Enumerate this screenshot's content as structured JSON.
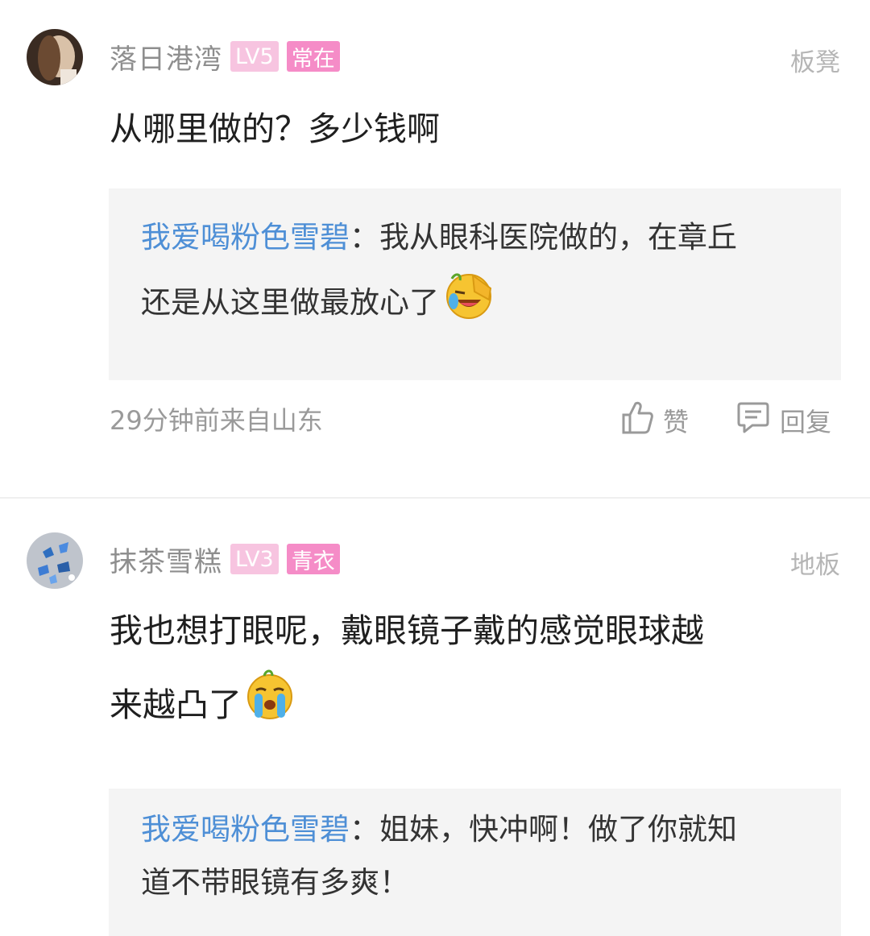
{
  "comments": [
    {
      "username": "落日港湾",
      "level": "LV5",
      "title_badge": "常在",
      "floor": "板凳",
      "text": "从哪里做的？多少钱啊",
      "reply": {
        "name": "我爱喝粉色雪碧",
        "sep": "：",
        "line1": "我从眼科医院做的，在章丘",
        "line2": "还是从这里做最放心了"
      },
      "time_location": "29分钟前来自山东",
      "like_label": "赞",
      "reply_label": "回复"
    },
    {
      "username": "抹茶雪糕",
      "level": "LV3",
      "title_badge": "青衣",
      "floor": "地板",
      "text_line1": "我也想打眼呢，戴眼镜子戴的感觉眼球越",
      "text_line2": "来越凸了",
      "reply": {
        "name": "我爱喝粉色雪碧",
        "sep": "：",
        "line1": "姐妹，快冲啊！做了你就知",
        "line2": "道不带眼镜有多爽！"
      }
    }
  ],
  "icons": {
    "like": "thumbs-up-icon",
    "reply": "comment-icon",
    "emoji1": "facepalm-laugh-emoji",
    "emoji2": "crying-emoji"
  },
  "colors": {
    "reply_name": "#4e8fd6",
    "level_badge": "#f7c4e0",
    "title_badge": "#f58cc7",
    "muted": "#9a9a9a",
    "reply_bg": "#f4f4f4"
  }
}
